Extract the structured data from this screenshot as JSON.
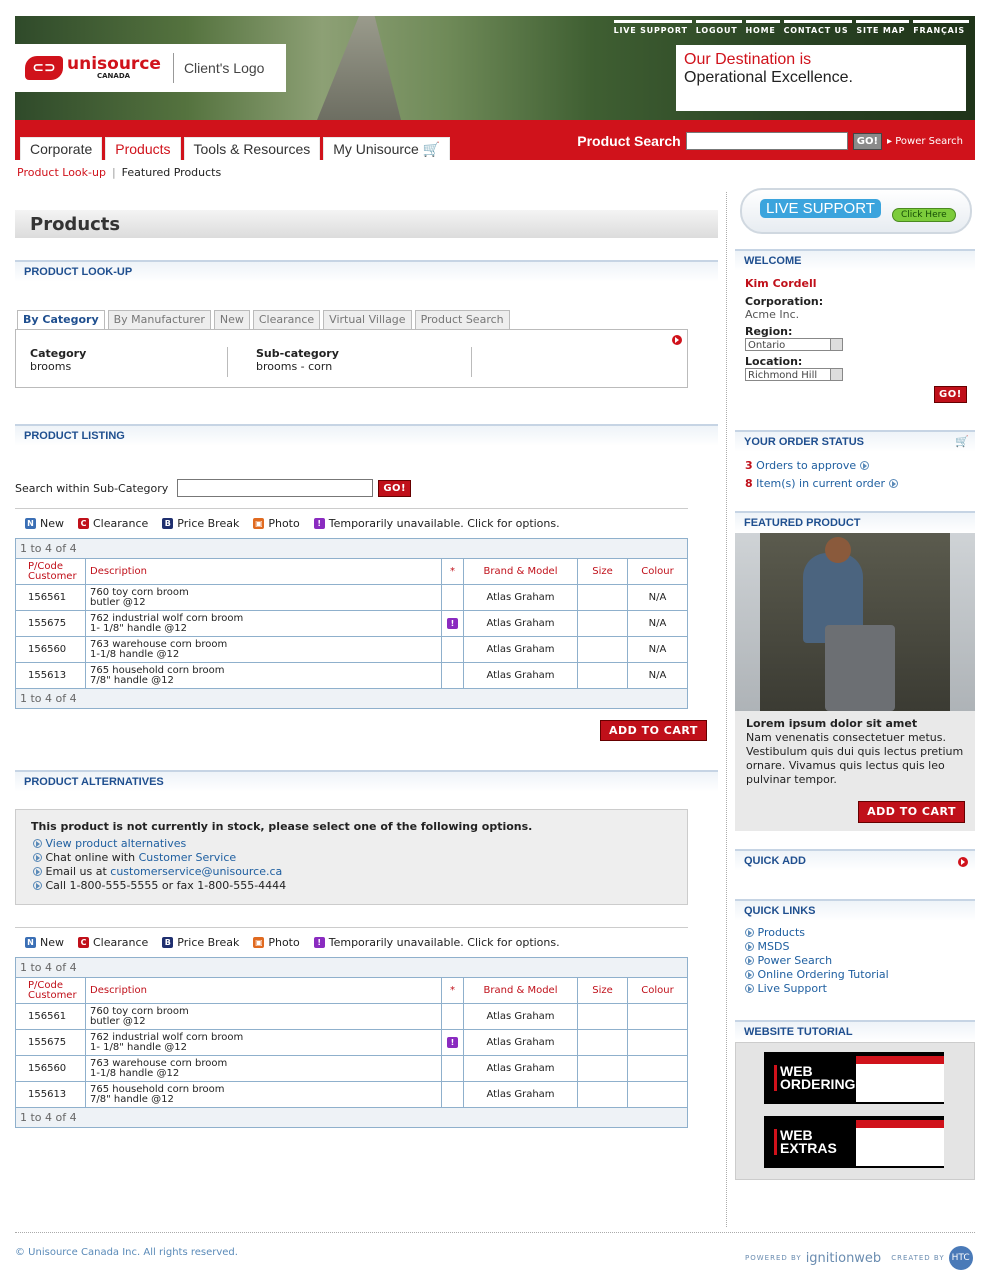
{
  "header": {
    "top_links": [
      "LIVE SUPPORT",
      "LOGOUT",
      "HOME",
      "CONTACT US",
      "SITE MAP",
      "FRANÇAIS"
    ],
    "brand": "unisource",
    "brand_sub": "CANADA",
    "client_logo": "Client's Logo",
    "tagline_1": "Our Destination is",
    "tagline_2": "Operational Excellence."
  },
  "nav": {
    "tabs": [
      "Corporate",
      "Products",
      "Tools & Resources",
      "My Unisource"
    ],
    "product_search_label": "Product Search",
    "go": "GO!",
    "power_search": "Power Search"
  },
  "breadcrumb": [
    "Product Look-up",
    "Featured Products"
  ],
  "page_title": "Products",
  "lookup": {
    "header": "PRODUCT LOOK-UP",
    "tabs": [
      "By Category",
      "By Manufacturer",
      "New",
      "Clearance",
      "Virtual Village",
      "Product Search"
    ],
    "category_label": "Category",
    "category_value": "brooms",
    "subcategory_label": "Sub-category",
    "subcategory_value": "brooms - corn"
  },
  "listing": {
    "header": "PRODUCT LISTING",
    "search_label": "Search within Sub-Category",
    "go": "GO!",
    "legend": [
      "New",
      "Clearance",
      "Price Break",
      "Photo",
      "Temporarily unavailable. Click for options."
    ],
    "pagination": "1 to 4 of 4",
    "columns": [
      "P/Code Customer",
      "Description",
      "*",
      "Brand & Model",
      "Size",
      "Colour"
    ],
    "rows": [
      {
        "code": "156561",
        "desc1": "760 toy corn broom",
        "desc2": "butler @12",
        "flag": "",
        "brand": "Atlas Graham",
        "size": "",
        "colour": "N/A"
      },
      {
        "code": "155675",
        "desc1": "762 industrial wolf corn broom",
        "desc2": "1- 1/8\" handle @12",
        "flag": "!",
        "brand": "Atlas Graham",
        "size": "",
        "colour": "N/A"
      },
      {
        "code": "156560",
        "desc1": "763 warehouse corn broom",
        "desc2": "1-1/8 handle @12",
        "flag": "",
        "brand": "Atlas Graham",
        "size": "",
        "colour": "N/A"
      },
      {
        "code": "155613",
        "desc1": "765 household corn broom",
        "desc2": "7/8\" handle @12",
        "flag": "",
        "brand": "Atlas Graham",
        "size": "",
        "colour": "N/A"
      }
    ],
    "add_to_cart": "ADD TO CART"
  },
  "alternatives": {
    "header": "PRODUCT ALTERNATIVES",
    "message": "This product is not currently in stock, please select one of the following options.",
    "opt1": "View product alternatives",
    "opt2_pre": "Chat online with ",
    "opt2_link": "Customer Service",
    "opt3_pre": "Email us at ",
    "opt3_link": "customerservice@unisource.ca",
    "opt4": "Call 1-800-555-5555 or fax 1-800-555-4444",
    "rows": [
      {
        "code": "156561",
        "desc1": "760 toy corn broom",
        "desc2": "butler @12",
        "flag": "",
        "brand": "Atlas Graham",
        "size": "",
        "colour": ""
      },
      {
        "code": "155675",
        "desc1": "762 industrial wolf corn broom",
        "desc2": "1- 1/8\" handle @12",
        "flag": "!",
        "brand": "Atlas Graham",
        "size": "",
        "colour": ""
      },
      {
        "code": "156560",
        "desc1": "763 warehouse corn broom",
        "desc2": "1-1/8 handle @12",
        "flag": "",
        "brand": "Atlas Graham",
        "size": "",
        "colour": ""
      },
      {
        "code": "155613",
        "desc1": "765 household corn broom",
        "desc2": "7/8\" handle @12",
        "flag": "",
        "brand": "Atlas Graham",
        "size": "",
        "colour": ""
      }
    ]
  },
  "sidebar": {
    "live_support": "LIVE SUPPORT",
    "click_here": "Click Here",
    "welcome_header": "WELCOME",
    "user": "Kim Cordell",
    "corp_label": "Corporation:",
    "corp": "Acme Inc.",
    "region_label": "Region:",
    "region": "Ontario",
    "location_label": "Location:",
    "location": "Richmond Hill",
    "go": "GO!",
    "order_header": "YOUR ORDER STATUS",
    "orders_count": "3",
    "orders_text": "Orders to approve",
    "items_count": "8",
    "items_text": "Item(s) in current order",
    "featured_header": "FEATURED PRODUCT",
    "featured_title": "Lorem ipsum dolor sit amet",
    "featured_body": "Nam venenatis consectetuer metus. Vestibulum quis dui quis lectus pretium ornare. Vivamus quis lectus quis leo pulvinar tempor.",
    "add_to_cart": "ADD TO CART",
    "quick_add": "QUICK ADD",
    "quick_links_header": "QUICK LINKS",
    "quick_links": [
      "Products",
      "MSDS",
      "Power Search",
      "Online Ordering Tutorial",
      "Live Support"
    ],
    "tutorial_header": "WEBSITE TUTORIAL",
    "tut1_a": "WEB",
    "tut1_b": "ORDERING",
    "tut2_a": "WEB",
    "tut2_b": "EXTRAS"
  },
  "footer": {
    "copyright": "© Unisource Canada Inc. All rights reserved.",
    "powered_by": "POWERED BY",
    "ignitionweb": "ignitionweb",
    "created_by": "CREATED BY",
    "htc": "HTC"
  },
  "colors": {
    "brand_red": "#d0121b",
    "link_blue": "#1f5fa0",
    "header_blue": "#1f4f8f"
  }
}
